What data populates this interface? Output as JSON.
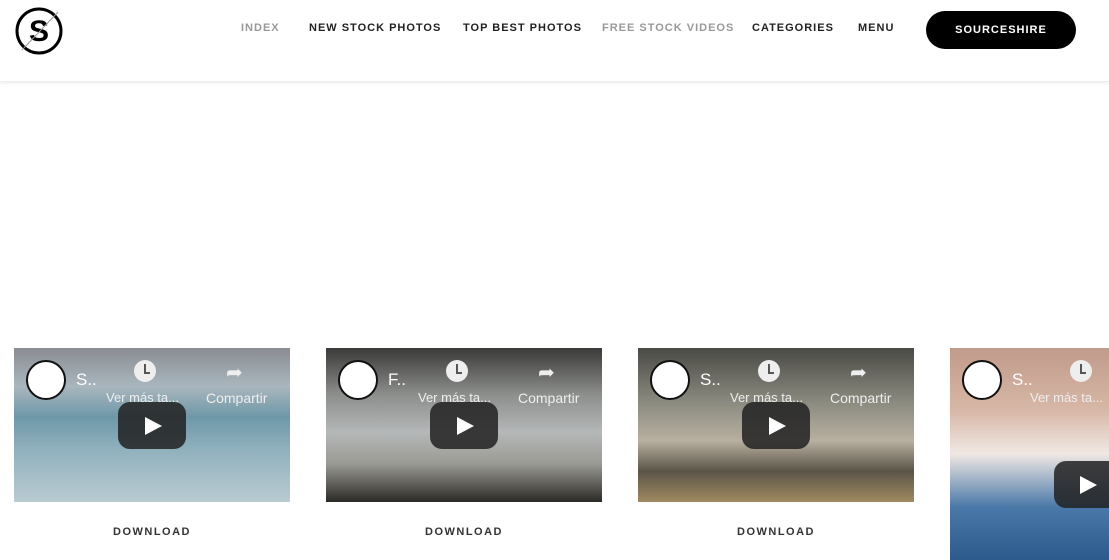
{
  "header": {
    "logo_text": "S",
    "nav": [
      {
        "label": "INDEX",
        "muted": true
      },
      {
        "label": "NEW STOCK PHOTOS",
        "muted": false
      },
      {
        "label": "TOP BEST PHOTOS",
        "muted": false
      },
      {
        "label": "FREE STOCK VIDEOS",
        "muted": true
      },
      {
        "label": "CATEGORIES",
        "muted": false
      },
      {
        "label": "MENU",
        "muted": false
      }
    ],
    "cta_label": "SOURCESHIRE"
  },
  "videos": [
    {
      "title": "S..",
      "watch_later": "Ver más ta...",
      "share": "Compartir",
      "download": "DOWNLOAD"
    },
    {
      "title": "F..",
      "watch_later": "Ver más ta...",
      "share": "Compartir",
      "download": "DOWNLOAD"
    },
    {
      "title": "S..",
      "watch_later": "Ver más ta...",
      "share": "Compartir",
      "download": "DOWNLOAD"
    },
    {
      "title": "S..",
      "watch_later": "Ver más ta..."
    }
  ]
}
